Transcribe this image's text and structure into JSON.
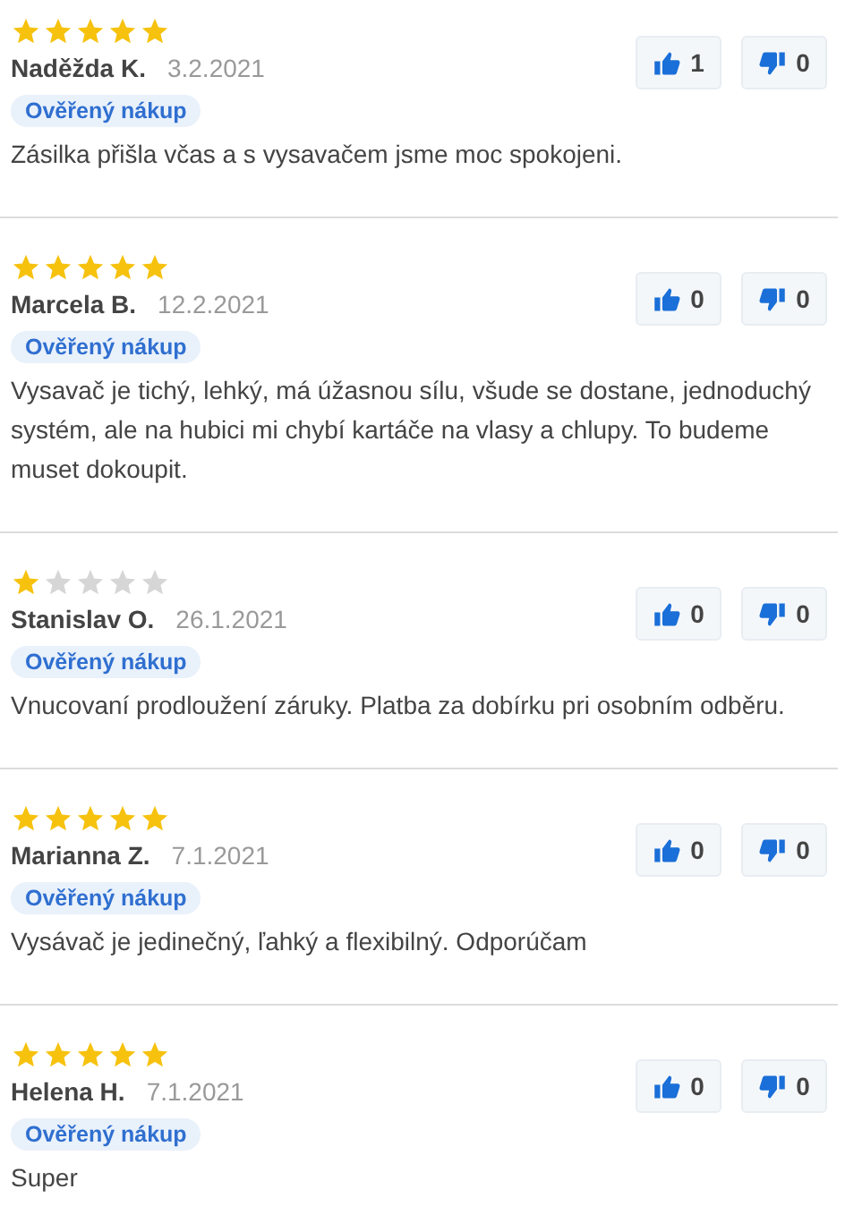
{
  "reviews": [
    {
      "stars": 5,
      "author": "Naděžda K.",
      "date": "3.2.2021",
      "badge": "Ověřený nákup",
      "text": "Zásilka přišla včas a s vysavačem jsme moc spokojeni.",
      "likes": "1",
      "dislikes": "0"
    },
    {
      "stars": 5,
      "author": "Marcela B.",
      "date": "12.2.2021",
      "badge": "Ověřený nákup",
      "text": "Vysavač je tichý, lehký, má úžasnou sílu, všude se dostane, jednoduchý systém, ale na hubici mi chybí kartáče na vlasy a chlupy. To budeme muset dokoupit.",
      "likes": "0",
      "dislikes": "0"
    },
    {
      "stars": 1,
      "author": "Stanislav O.",
      "date": "26.1.2021",
      "badge": "Ověřený nákup",
      "text": "Vnucovaní prodloužení záruky. Platba za dobírku pri osobním odběru.",
      "likes": "0",
      "dislikes": "0"
    },
    {
      "stars": 5,
      "author": "Marianna Z.",
      "date": "7.1.2021",
      "badge": "Ověřený nákup",
      "text": "Vysávač je jedinečný, ľahký a flexibilný. Odporúčam",
      "likes": "0",
      "dislikes": "0"
    },
    {
      "stars": 5,
      "author": "Helena H.",
      "date": "7.1.2021",
      "badge": "Ověřený nákup",
      "text": "Super",
      "likes": "0",
      "dislikes": "0"
    }
  ]
}
